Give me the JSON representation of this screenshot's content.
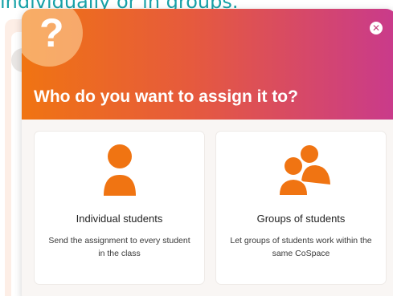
{
  "background": {
    "text": "individually or in groups."
  },
  "modal": {
    "header_icon": "question-mark-icon",
    "header_glyph": "?",
    "title": "Who do you want to assign it to?",
    "close_icon": "close-icon",
    "close_glyph": "✕"
  },
  "options": [
    {
      "icon": "person-icon",
      "title": "Individual students",
      "description": "Send the assignment to every student in the class"
    },
    {
      "icon": "group-icon",
      "title": "Groups of students",
      "description": "Let groups of students work within the same CoSpace"
    }
  ],
  "colors": {
    "accent_orange": "#f07412",
    "accent_pink": "#c93a8c",
    "icon_orange": "#f07412",
    "background_text": "#17a2a8"
  }
}
